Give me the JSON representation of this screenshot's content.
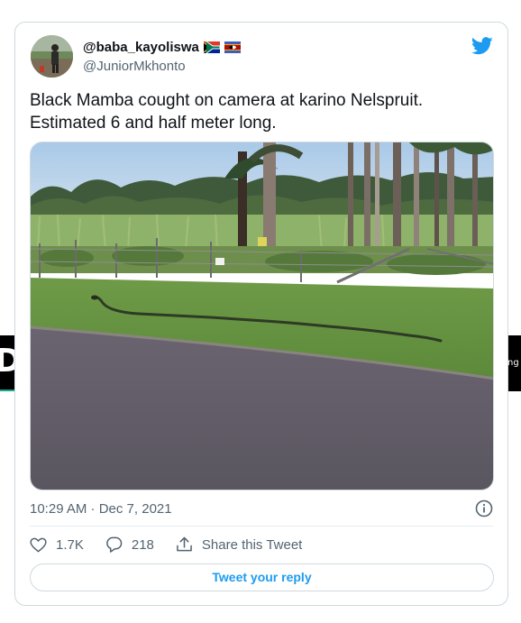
{
  "side_left_text": "DF",
  "side_right_text": "ng",
  "tweet": {
    "display_name": "@baba_kayoliswa",
    "handle": "@JuniorMkhonto",
    "text": "Black Mamba cought on camera at karino Nelspruit. Estimated 6 and half meter long.",
    "timestamp": "10:29 AM · Dec 7, 2021",
    "likes": "1.7K",
    "replies": "218",
    "share_label": "Share this Tweet",
    "reply_button": "Tweet your reply"
  },
  "colors": {
    "twitter_blue": "#1d9bf0",
    "secondary_text": "#536471",
    "border": "#cfd9de"
  },
  "icons": [
    "avatar",
    "south-africa-flag-icon",
    "eswatini-flag-icon",
    "twitter-bird-icon",
    "info-icon",
    "heart-icon",
    "reply-icon",
    "share-icon"
  ]
}
